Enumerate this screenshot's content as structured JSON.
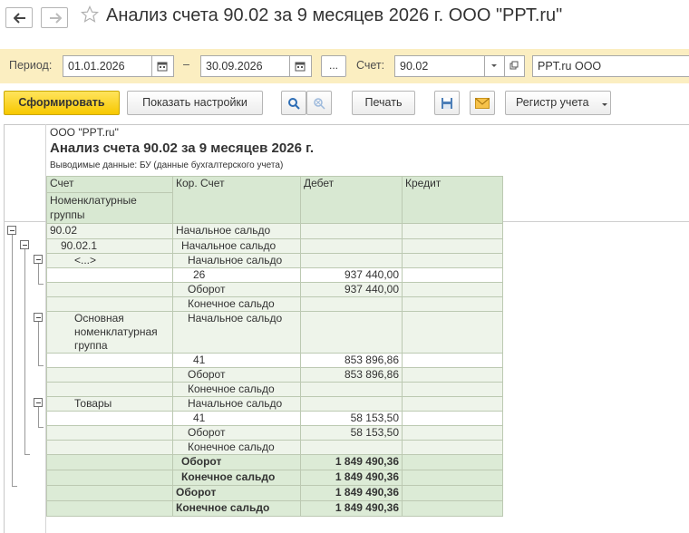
{
  "window": {
    "title": "Анализ счета 90.02 за 9 месяцев 2026 г. ООО \"РРТ.ru\""
  },
  "params": {
    "period_label": "Период:",
    "date_from": "01.01.2026",
    "dash": "–",
    "ellipsis": "...",
    "account_label": "Счет:",
    "account_value": "90.02",
    "org_value": "PPT.ru ООО"
  },
  "toolbar": {
    "generate": "Сформировать",
    "show_settings": "Показать настройки",
    "print": "Печать",
    "register": "Регистр учета"
  },
  "report": {
    "org": "ООО \"PPT.ru\"",
    "title": "Анализ счета 90.02 за 9 месяцев 2026 г.",
    "output": "Выводимые данные: БУ (данные бухгалтерского учета)",
    "headers": {
      "account": "Счет",
      "nomen": "Номенклатурные группы",
      "corr": "Кор. Счет",
      "debit": "Дебет",
      "credit": "Кредит"
    },
    "rows": [
      {
        "a": "90.02",
        "c": "Начальное сальдо",
        "d": "",
        "k": ""
      },
      {
        "a": "90.02.1",
        "c": "Начальное сальдо",
        "d": "",
        "k": ""
      },
      {
        "a": "<...>",
        "c": "Начальное сальдо",
        "d": "",
        "k": ""
      },
      {
        "a": "",
        "c": "26",
        "d": "937 440,00",
        "k": ""
      },
      {
        "a": "",
        "c": "Оборот",
        "d": "937 440,00",
        "k": ""
      },
      {
        "a": "",
        "c": "Конечное сальдо",
        "d": "",
        "k": ""
      },
      {
        "a": "Основная номенклатурная группа",
        "c": "Начальное сальдо",
        "d": "",
        "k": ""
      },
      {
        "a": "",
        "c": "41",
        "d": "853 896,86",
        "k": ""
      },
      {
        "a": "",
        "c": "Оборот",
        "d": "853 896,86",
        "k": ""
      },
      {
        "a": "",
        "c": "Конечное сальдо",
        "d": "",
        "k": ""
      },
      {
        "a": "Товары",
        "c": "Начальное сальдо",
        "d": "",
        "k": ""
      },
      {
        "a": "",
        "c": "41",
        "d": "58 153,50",
        "k": ""
      },
      {
        "a": "",
        "c": "Оборот",
        "d": "58 153,50",
        "k": ""
      },
      {
        "a": "",
        "c": "Конечное сальдо",
        "d": "",
        "k": ""
      },
      {
        "a": "",
        "c": "Оборот",
        "d": "1 849 490,36",
        "k": ""
      },
      {
        "a": "",
        "c": "Конечное сальдо",
        "d": "1 849 490,36",
        "k": ""
      },
      {
        "a": "",
        "c": "Оборот",
        "d": "1 849 490,36",
        "k": ""
      },
      {
        "a": "",
        "c": "Конечное сальдо",
        "d": "1 849 490,36",
        "k": ""
      }
    ]
  }
}
